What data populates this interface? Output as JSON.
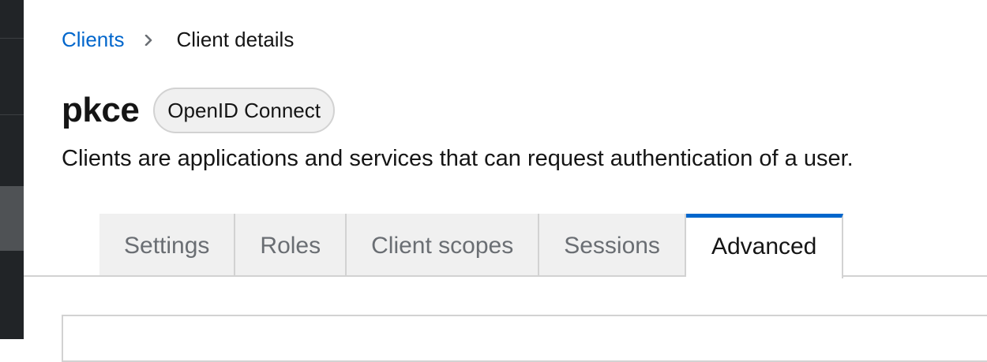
{
  "breadcrumb": {
    "parent_label": "Clients",
    "current_label": "Client details"
  },
  "header": {
    "title": "pkce",
    "protocol_badge": "OpenID Connect",
    "description": "Clients are applications and services that can request authentication of a user."
  },
  "tabs": [
    {
      "label": "Settings",
      "active": false
    },
    {
      "label": "Roles",
      "active": false
    },
    {
      "label": "Client scopes",
      "active": false
    },
    {
      "label": "Sessions",
      "active": false
    },
    {
      "label": "Advanced",
      "active": true
    }
  ],
  "icons": {
    "breadcrumb_separator": "chevron-right-icon"
  },
  "colors": {
    "link": "#0066cc",
    "active_tab_border": "#0066cc",
    "inactive_tab_bg": "#f0f0f0",
    "sidebar_bg": "#212427"
  }
}
